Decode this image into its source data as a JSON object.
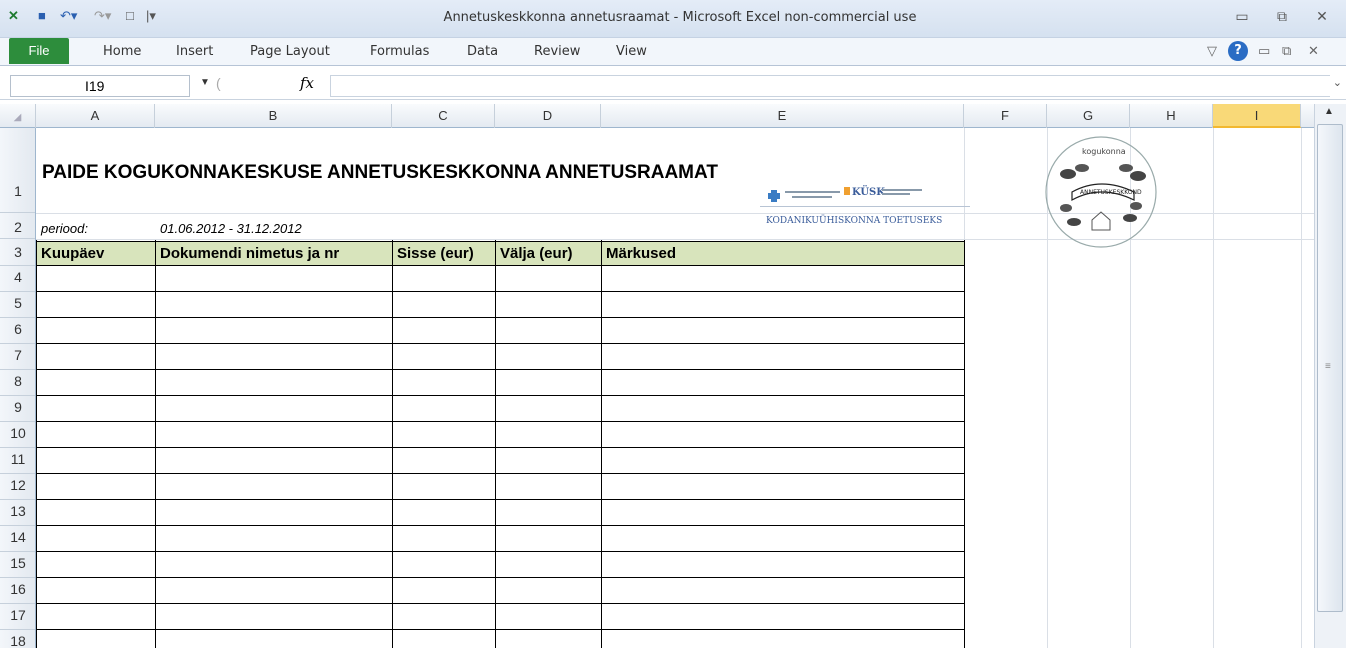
{
  "window": {
    "title": "Annetuskeskkonna annetusraamat - Microsoft Excel non-commercial use"
  },
  "ribbon": {
    "tabs": [
      "File",
      "Home",
      "Insert",
      "Page Layout",
      "Formulas",
      "Data",
      "Review",
      "View"
    ]
  },
  "formula_bar": {
    "name_box": "I19",
    "fx_label": "fx",
    "content": ""
  },
  "columns": [
    "A",
    "B",
    "C",
    "D",
    "E",
    "F",
    "G",
    "H",
    "I"
  ],
  "selected_column": "I",
  "rows": [
    "1",
    "2",
    "3",
    "4",
    "5",
    "6",
    "7",
    "8",
    "9",
    "10",
    "11",
    "12",
    "13",
    "14",
    "15",
    "16",
    "17",
    "18"
  ],
  "sheet": {
    "title": "PAIDE KOGUKONNAKESKUSE ANNETUSKESKKONNA ANNETUSRAAMAT",
    "period_label": "periood:",
    "period_value": "01.06.2012 - 31.12.2012",
    "table_headers": [
      "Kuupäev",
      "Dokumendi nimetus ja nr",
      "Sisse (eur)",
      "Välja (eur)",
      "Märkused"
    ]
  },
  "logos": {
    "left": "REGIONAALMINISTRI VALITSEMISALA KÜSK KODANIKUÜHISKONNA TOETUSEKS",
    "right": "kogukonna ANNETUSKESKKOND"
  },
  "colors": {
    "header_fill": "#d8e4bc",
    "file_tab": "#2d8d3c",
    "selected_col": "#f9d978"
  }
}
